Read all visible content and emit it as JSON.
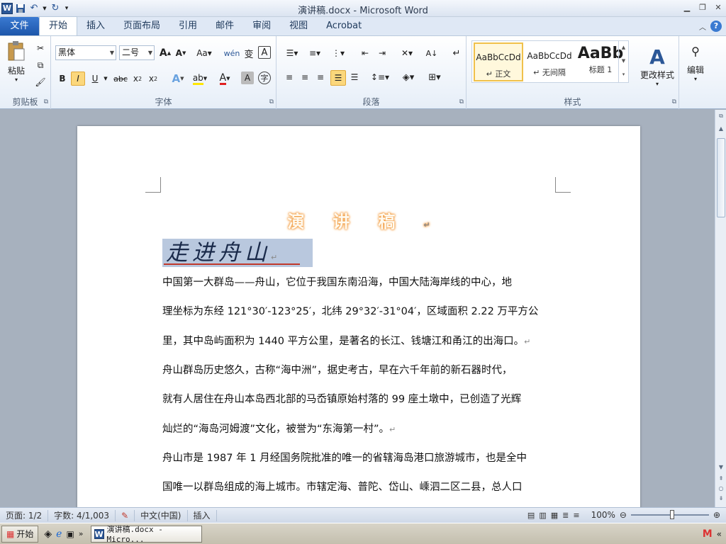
{
  "window": {
    "title": "演讲稿.docx - Microsoft Word"
  },
  "tabs": [
    "文件",
    "开始",
    "插入",
    "页面布局",
    "引用",
    "邮件",
    "审阅",
    "视图",
    "Acrobat"
  ],
  "ribbon": {
    "clipboard": {
      "paste_label": "粘贴",
      "group_label": "剪贴板"
    },
    "font": {
      "font_name": "黑体",
      "font_size": "二号",
      "group_label": "字体"
    },
    "paragraph": {
      "group_label": "段落"
    },
    "styles": {
      "group_label": "样式",
      "items": [
        {
          "sample": "AaBbCcDd",
          "name": "↵ 正文"
        },
        {
          "sample": "AaBbCcDd",
          "name": "↵ 无间隔"
        },
        {
          "sample": "AaBb",
          "name": "标题 1"
        }
      ],
      "change_styles": "更改样式"
    },
    "editing": {
      "label": "编辑"
    }
  },
  "document": {
    "title": "演讲稿",
    "subtitle": "走进舟山",
    "paragraphs": [
      [
        "中国第一大群岛——舟山，它位于我国东南沿海，中国大陆海岸线的中心，地",
        "理坐标为东经 121°30′-123°25′，北纬 29°32′-31°04′，区域面积 2.22 万平方公",
        "里，其中岛屿面积为 1440 平方公里，是著名的长江、钱塘江和甬江的出海口。"
      ],
      [
        "舟山群岛历史悠久，古称“海中洲”，据史考古，早在六千年前的新石器时代，",
        "就有人居住在舟山本岛西北部的马岙镇原始村落的 99 座土墩中，已创造了光辉",
        "灿烂的“海岛河姆渡”文化，被誉为“东海第一村”。"
      ],
      [
        "舟山市是 1987 年 1 月经国务院批准的唯一的省辖海岛港口旅游城市，也是全中",
        "国唯一以群岛组成的海上城市。市辖定海、普陀、岱山、嵊泗二区二县，总人口"
      ]
    ]
  },
  "status": {
    "page": "页面: 1/2",
    "words": "字数: 4/1,003",
    "language": "中文(中国)",
    "mode": "插入",
    "zoom": "100%"
  },
  "taskbar": {
    "start": "开始",
    "task": "演讲稿.docx - Micro..."
  }
}
